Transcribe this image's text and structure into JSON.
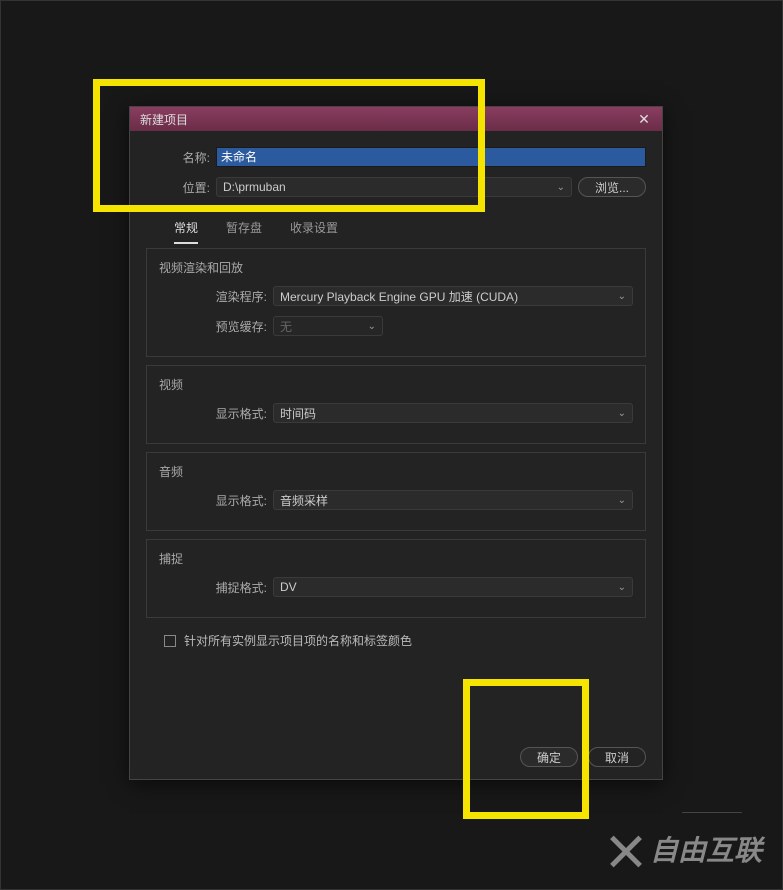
{
  "dialog": {
    "title": "新建项目",
    "name_label": "名称:",
    "name_value": "未命名",
    "location_label": "位置:",
    "location_value": "D:\\prmuban",
    "browse_label": "浏览...",
    "tabs": [
      {
        "label": "常规",
        "active": true
      },
      {
        "label": "暂存盘",
        "active": false
      },
      {
        "label": "收录设置",
        "active": false
      }
    ],
    "sections": {
      "rendering": {
        "title": "视频渲染和回放",
        "renderer_label": "渲染程序:",
        "renderer_value": "Mercury Playback Engine GPU 加速 (CUDA)",
        "cache_label": "预览缓存:",
        "cache_value": "无"
      },
      "video": {
        "title": "视频",
        "format_label": "显示格式:",
        "format_value": "时间码"
      },
      "audio": {
        "title": "音频",
        "format_label": "显示格式:",
        "format_value": "音频采样"
      },
      "capture": {
        "title": "捕捉",
        "format_label": "捕捉格式:",
        "format_value": "DV"
      }
    },
    "checkbox_label": "针对所有实例显示项目项的名称和标签颜色",
    "ok_label": "确定",
    "cancel_label": "取消"
  },
  "watermark": "自由互联"
}
